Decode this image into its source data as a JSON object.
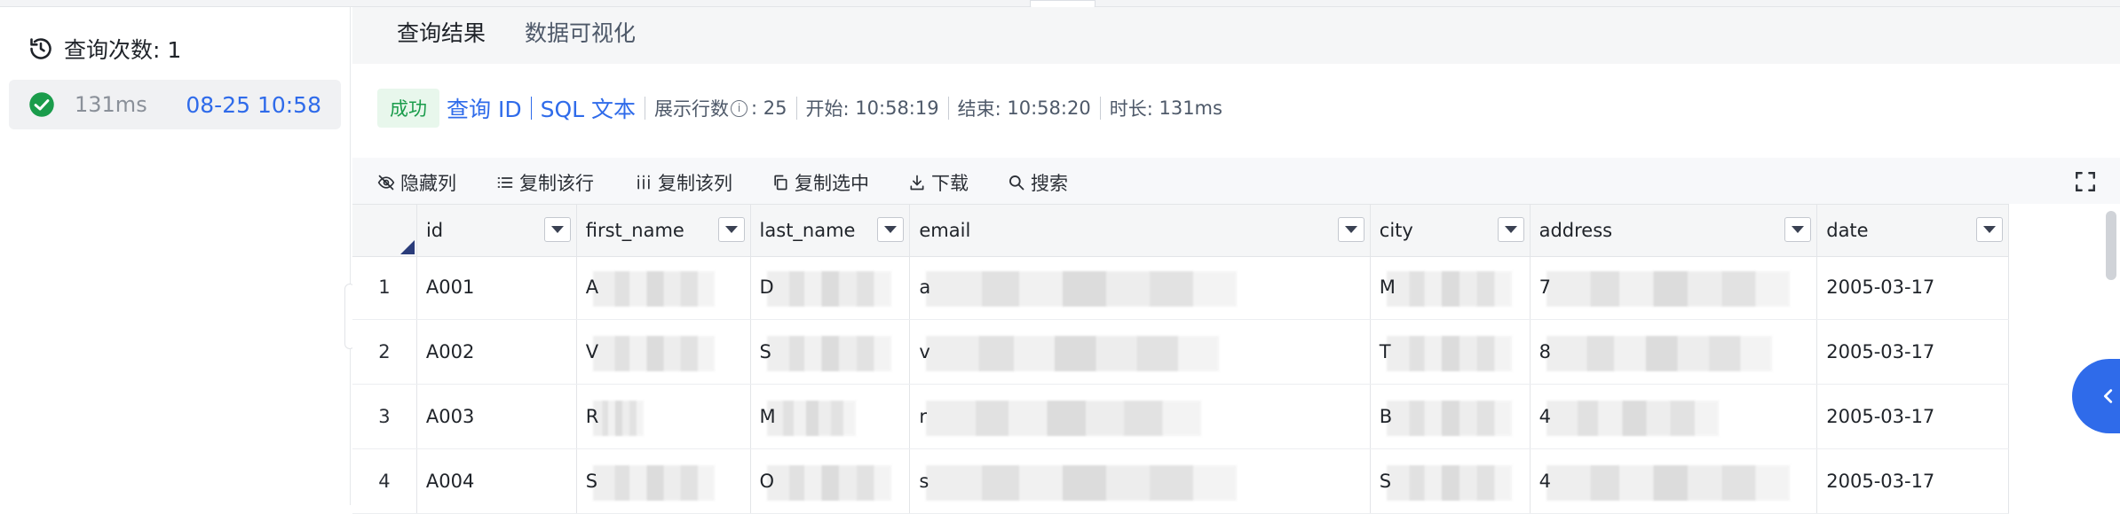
{
  "history": {
    "count_label": "查询次数: 1",
    "item": {
      "duration": "131ms",
      "datetime": "08-25 10:58"
    }
  },
  "tabs": {
    "result": "查询结果",
    "visualize": "数据可视化"
  },
  "status": {
    "badge": "成功",
    "query_id": "查询 ID",
    "sql_text": "SQL 文本",
    "rows_label": "展示行数",
    "rows_value": "25",
    "start_label": "开始:",
    "start_value": "10:58:19",
    "end_label": "结束:",
    "end_value": "10:58:20",
    "duration_label": "时长:",
    "duration_value": "131ms"
  },
  "toolbar": {
    "hide_columns": "隐藏列",
    "copy_row": "复制该行",
    "copy_column": "复制该列",
    "copy_selected": "复制选中",
    "download": "下载",
    "search": "搜索"
  },
  "table": {
    "columns": [
      "id",
      "first_name",
      "last_name",
      "email",
      "city",
      "address",
      "date"
    ],
    "rows": [
      {
        "num": "1",
        "id": "A001",
        "first_name": "A",
        "last_name": "D",
        "email": "a",
        "city": "M",
        "address": "7",
        "date": "2005-03-17"
      },
      {
        "num": "2",
        "id": "A002",
        "first_name": "V",
        "last_name": "S",
        "email": "v",
        "city": "T",
        "address": "8",
        "date": "2005-03-17"
      },
      {
        "num": "3",
        "id": "A003",
        "first_name": "R",
        "last_name": "M",
        "email": "r",
        "city": "B",
        "address": "4",
        "date": "2005-03-17"
      },
      {
        "num": "4",
        "id": "A004",
        "first_name": "S",
        "last_name": "O",
        "email": "s",
        "city": "S",
        "address": "4",
        "date": "2005-03-17"
      }
    ]
  },
  "colors": {
    "accent": "#2f6bea",
    "success": "#1a9c4b",
    "success_bg": "#e8f7ec"
  }
}
